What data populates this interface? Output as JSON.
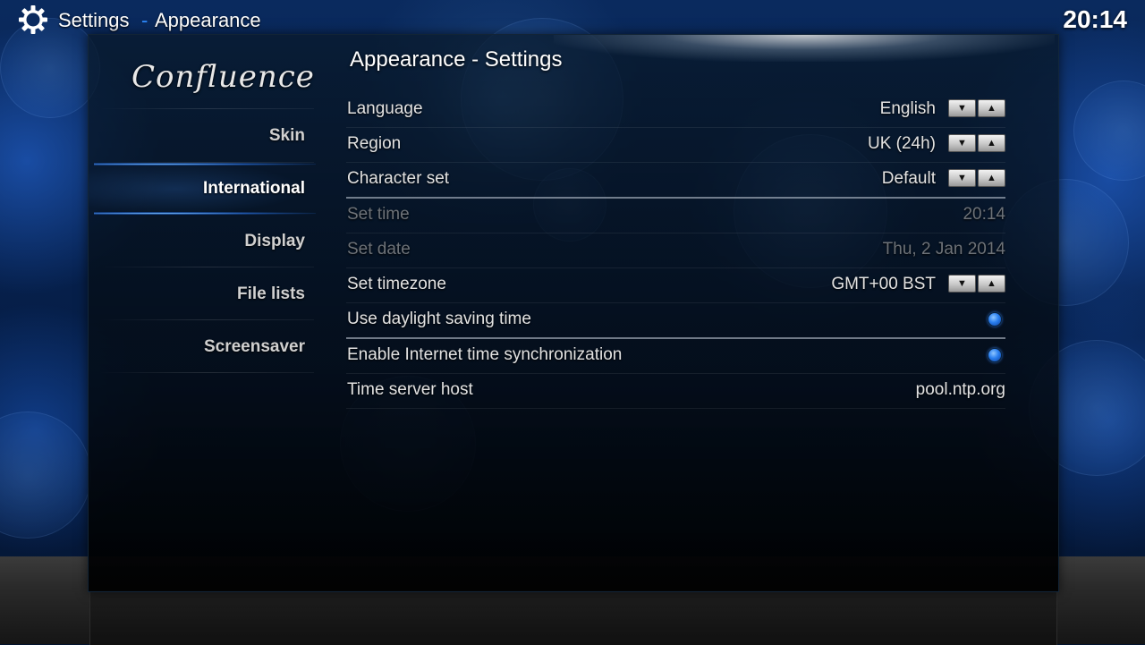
{
  "header": {
    "title": "Settings",
    "separator": "-",
    "subtitle": "Appearance",
    "clock": "20:14"
  },
  "sidebar": {
    "logo_text": "Confluence",
    "items": [
      {
        "label": "Skin",
        "active": false
      },
      {
        "label": "International",
        "active": true
      },
      {
        "label": "Display",
        "active": false
      },
      {
        "label": "File lists",
        "active": false
      },
      {
        "label": "Screensaver",
        "active": false
      }
    ]
  },
  "main": {
    "heading": "Appearance - Settings",
    "settings": [
      {
        "label": "Language",
        "value": "English",
        "control": "spinner",
        "enabled": true
      },
      {
        "label": "Region",
        "value": "UK (24h)",
        "control": "spinner",
        "enabled": true
      },
      {
        "label": "Character set",
        "value": "Default",
        "control": "spinner",
        "enabled": true
      },
      {
        "label": "Set time",
        "value": "20:14",
        "control": "text",
        "enabled": false
      },
      {
        "label": "Set date",
        "value": "Thu, 2 Jan 2014",
        "control": "text",
        "enabled": false
      },
      {
        "label": "Set timezone",
        "value": "GMT+00 BST",
        "control": "spinner",
        "enabled": true
      },
      {
        "label": "Use daylight saving time",
        "control": "radio",
        "checked": true,
        "enabled": true
      },
      {
        "label": "Enable Internet time synchronization",
        "control": "radio",
        "checked": true,
        "enabled": true
      },
      {
        "label": "Time server host",
        "value": "pool.ntp.org",
        "control": "text",
        "enabled": true
      }
    ]
  },
  "icons": {
    "spinner_down": "▼",
    "spinner_up": "▲",
    "gear": "gear-icon"
  },
  "colors": {
    "accent": "#2f8cff",
    "text": "#e2e2e2",
    "disabled_text": "#6d7278"
  }
}
